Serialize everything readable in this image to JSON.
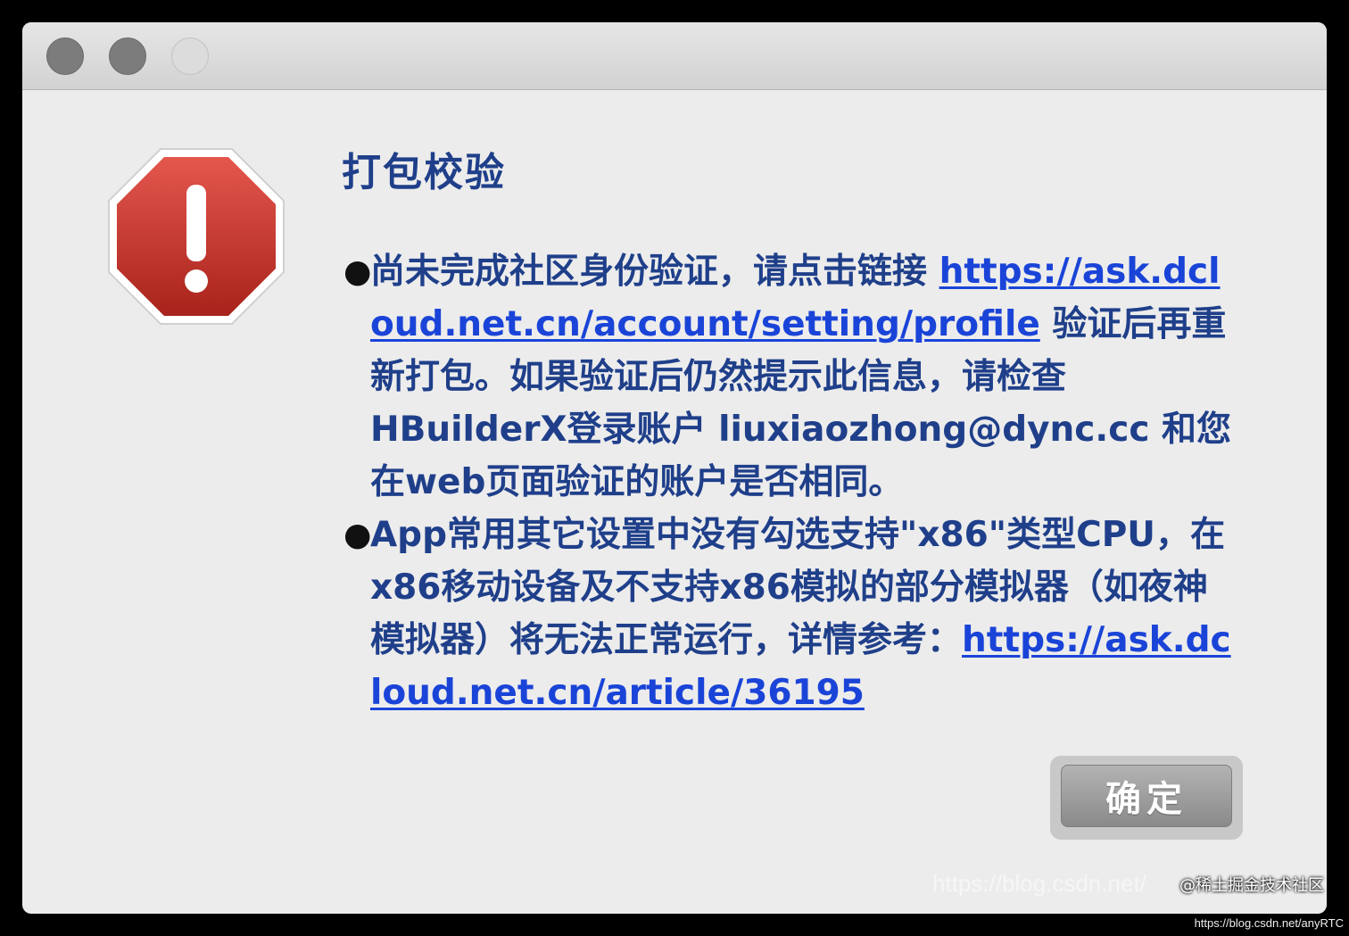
{
  "dialog": {
    "title": "打包校验",
    "messages": [
      {
        "before": "尚未完成社区身份验证，请点击链接 ",
        "link": "https://ask.dcloud.net.cn/account/setting/profile",
        "after": " 验证后再重新打包。如果验证后仍然提示此信息，请检查HBuilderX登录账户 liuxiaozhong@dync.cc 和您在web页面验证的账户是否相同。"
      },
      {
        "before": "App常用其它设置中没有勾选支持\"x86\"类型CPU，在x86移动设备及不支持x86模拟的部分模拟器（如夜神模拟器）将无法正常运行，详情参考：",
        "link": "https://ask.dcloud.net.cn/article/36195",
        "after": ""
      }
    ],
    "ok_label": "确定",
    "icon": "stop-alert-icon"
  },
  "window_controls": [
    "close-icon",
    "minimize-icon",
    "zoom-icon"
  ],
  "watermark": {
    "overlay": "https://blog.csdn.net/",
    "badge": "@稀土掘金技术社区",
    "url": "https://blog.csdn.net/anyRTC"
  },
  "colors": {
    "text": "#1f3f8a",
    "link": "#1a44d8",
    "alert_red": "#c62f26"
  }
}
